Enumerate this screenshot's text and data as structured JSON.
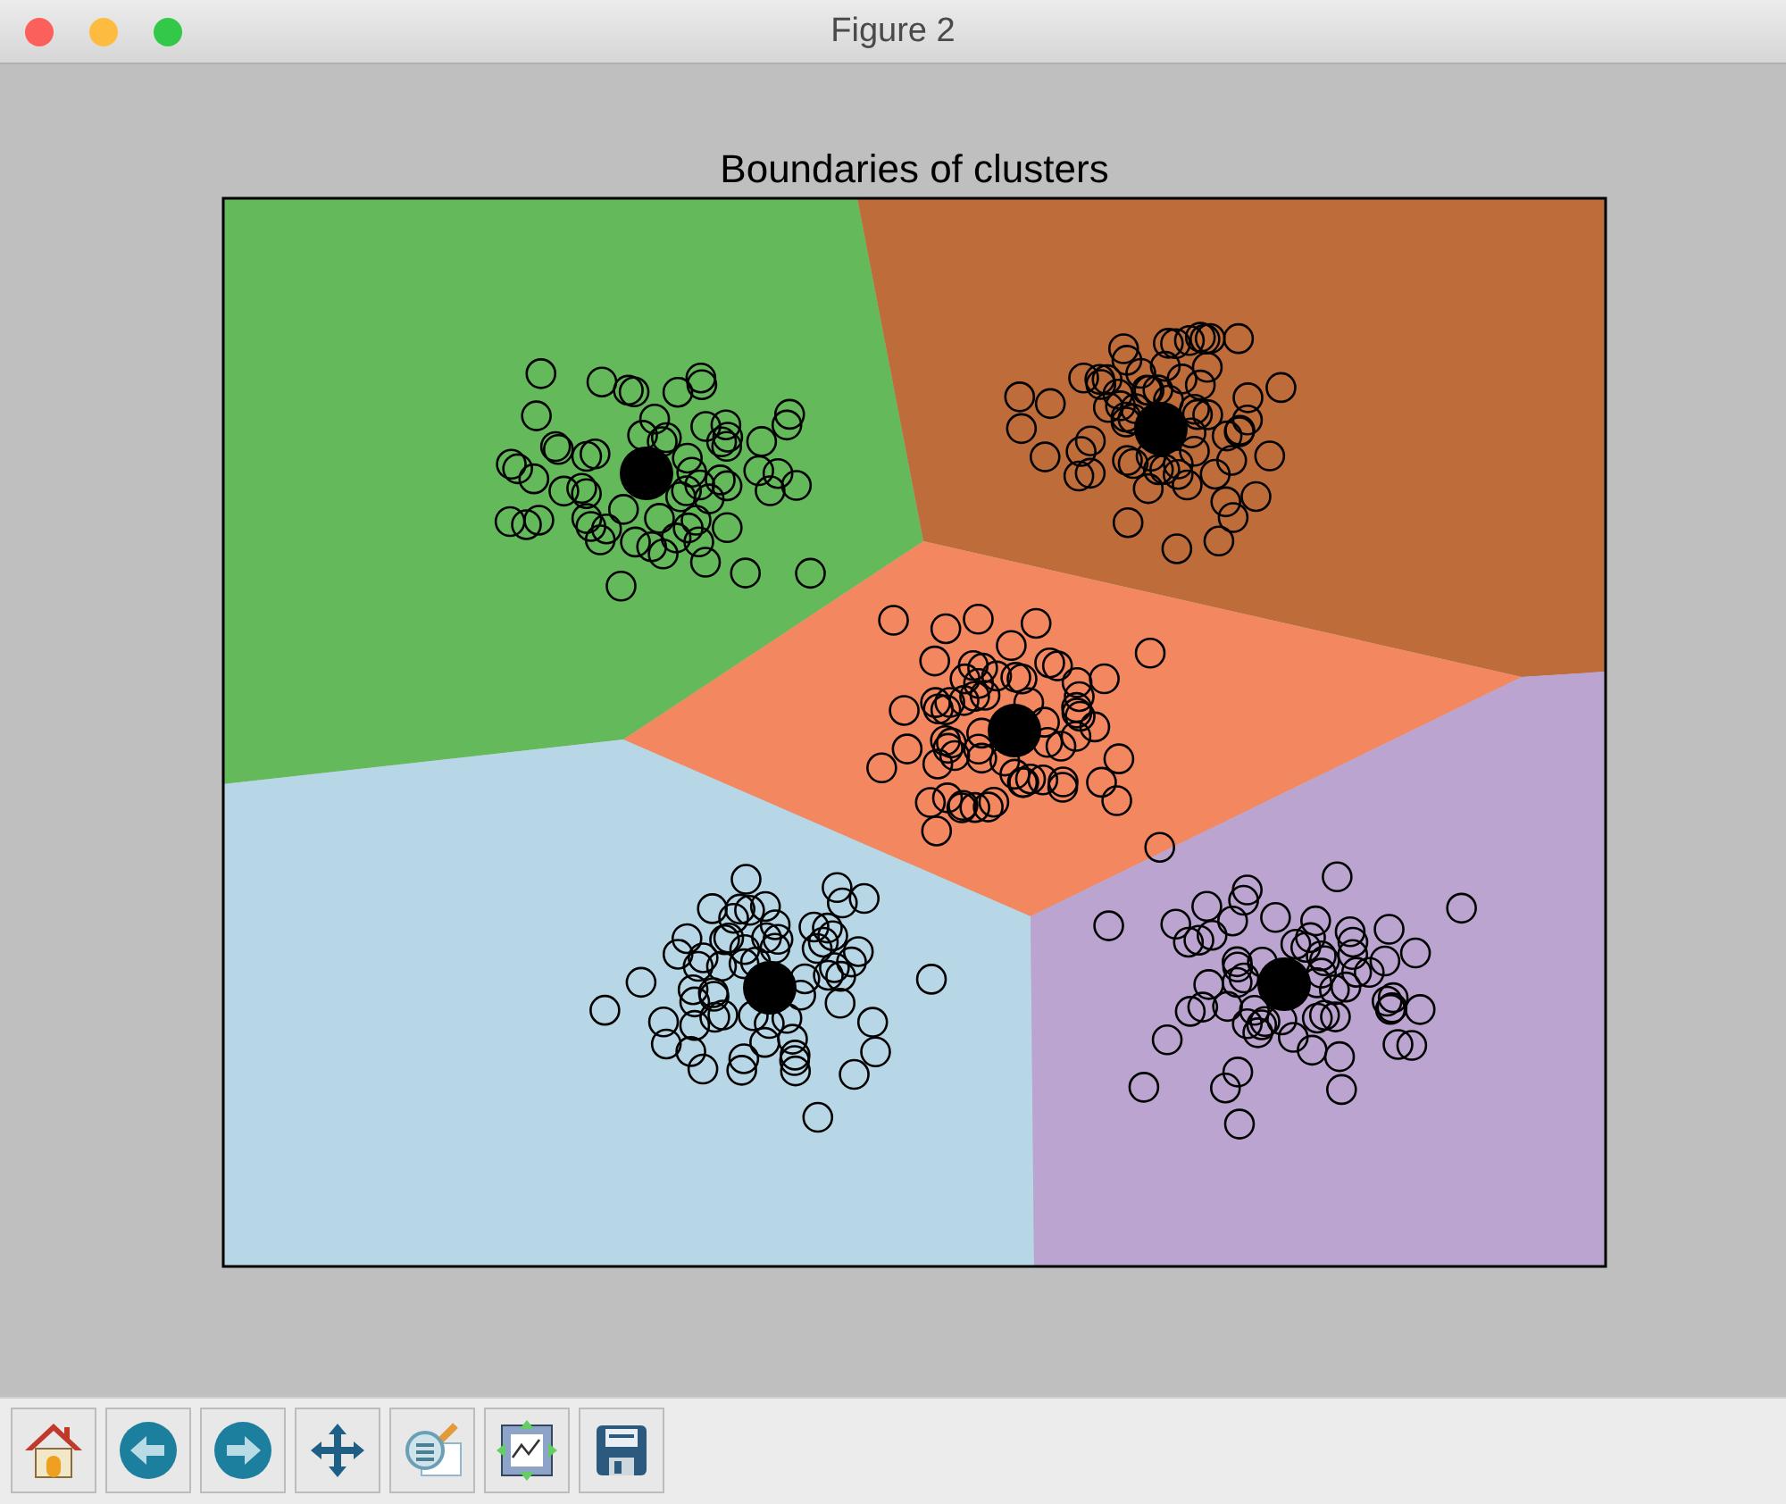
{
  "window": {
    "title": "Figure 2"
  },
  "figure": {
    "title": "Boundaries of clusters"
  },
  "toolbar": {
    "buttons": [
      {
        "kind": "home"
      },
      {
        "kind": "back"
      },
      {
        "kind": "forward"
      },
      {
        "kind": "pan"
      },
      {
        "kind": "zoom"
      },
      {
        "kind": "subplots"
      },
      {
        "kind": "save"
      }
    ]
  }
}
